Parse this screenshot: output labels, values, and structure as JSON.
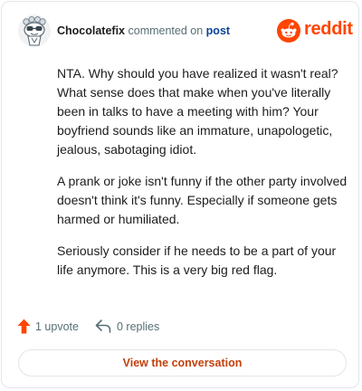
{
  "brand": {
    "name": "reddit",
    "logo_icon": "reddit-snoo-icon",
    "color": "#ff4500"
  },
  "comment": {
    "username": "Chocolatefix",
    "action_text": "commented on",
    "post_link": "post",
    "avatar_icon": "snoo-avatar-icon",
    "paragraphs": [
      "NTA. Why should you have realized it wasn't real? What sense does that make when you've literally been in talks to have a meeting with him? Your boyfriend sounds like an immature, unapologetic, jealous, sabotaging idiot.",
      "A prank or joke isn't funny if the other party involved doesn't think it's funny. Especially if someone gets harmed or humiliated.",
      "Seriously consider if he needs to be a part of your life anymore. This is a very big red flag."
    ]
  },
  "actions": {
    "upvote_label": "1 upvote",
    "upvote_icon": "upvote-arrow-icon",
    "replies_label": "0 replies",
    "reply_icon": "reply-arrow-icon",
    "upvote_color": "#ff4500"
  },
  "cta": {
    "label": "View the conversation",
    "color": "#c2410c"
  }
}
